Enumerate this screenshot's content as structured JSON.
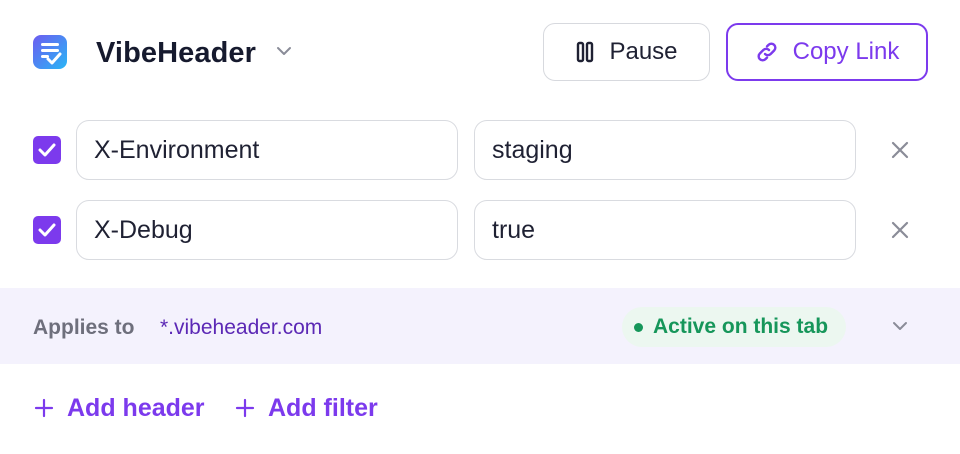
{
  "colors": {
    "accent": "#7c3aed",
    "text": "#1f2133",
    "muted": "#6e6f7c",
    "border": "#d9dbe0",
    "filter_bg": "#f4f2fd",
    "status_green": "#16965a",
    "status_bg": "#ecf7f0",
    "logo_gradient": [
      "#6d5cf0",
      "#29b6f6"
    ]
  },
  "header": {
    "logo_icon": "document-check-icon",
    "profile_name": "VibeHeader",
    "profile_menu_icon": "chevron-down-icon",
    "pause_button": {
      "label": "Pause",
      "icon": "pause-icon"
    },
    "copy_link_button": {
      "label": "Copy Link",
      "icon": "link-icon"
    }
  },
  "headers": [
    {
      "enabled": true,
      "name": "X-Environment",
      "value": "staging",
      "remove_icon": "close-icon"
    },
    {
      "enabled": true,
      "name": "X-Debug",
      "value": "true",
      "remove_icon": "close-icon"
    }
  ],
  "filter": {
    "label": "Applies to",
    "domain": "*.vibeheader.com",
    "status": "Active on this tab",
    "expand_icon": "chevron-down-icon"
  },
  "actions": {
    "add_header": "Add header",
    "add_filter": "Add filter",
    "icon": "plus-icon"
  }
}
